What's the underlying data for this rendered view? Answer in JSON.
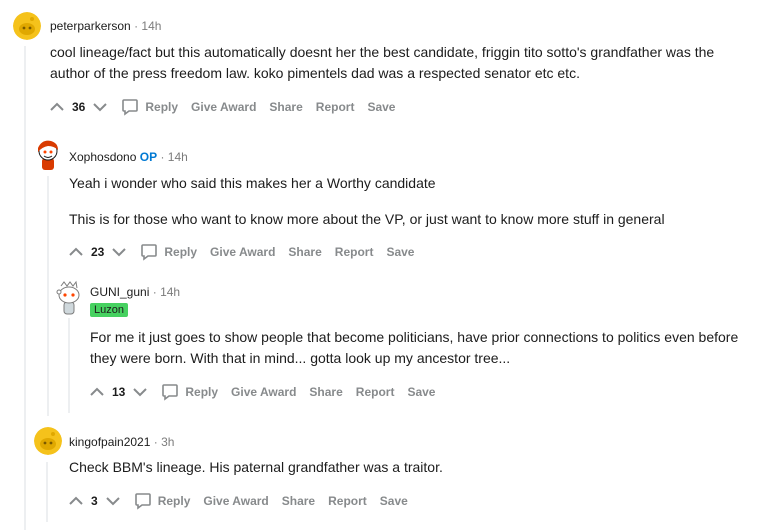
{
  "comments": [
    {
      "author": "peterparkerson",
      "op_badge": "",
      "time": "14h",
      "flair": "",
      "paragraphs": [
        "cool lineage/fact but this automatically doesnt her the best candidate, friggin tito sotto's grandfather was the author of the press freedom law. koko pimentels dad was a respected senator etc etc."
      ],
      "score": "36"
    },
    {
      "author": "Xophosdono",
      "op_badge": "OP",
      "time": "14h",
      "flair": "",
      "paragraphs": [
        "Yeah i wonder who said this makes her a Worthy candidate",
        "This is for those who want to know more about the VP, or just want to know more stuff in general"
      ],
      "score": "23"
    },
    {
      "author": "GUNI_guni",
      "op_badge": "",
      "time": "14h",
      "flair": "Luzon",
      "paragraphs": [
        "For me it just goes to show people that become politicians, have prior connections to politics even before they were born. With that in mind... gotta look up my ancestor tree..."
      ],
      "score": "13"
    },
    {
      "author": "kingofpain2021",
      "op_badge": "",
      "time": "3h",
      "flair": "",
      "paragraphs": [
        "Check BBM's lineage. His paternal grandfather was a traitor."
      ],
      "score": "3"
    }
  ],
  "actions": {
    "reply": "Reply",
    "give_award": "Give Award",
    "share": "Share",
    "report": "Report",
    "save": "Save"
  },
  "separator": "·",
  "colors": {
    "op_blue": "#0079d3",
    "flair_green": "#46d160",
    "action_gray": "#878a8c",
    "thread_line": "#edeff1"
  }
}
